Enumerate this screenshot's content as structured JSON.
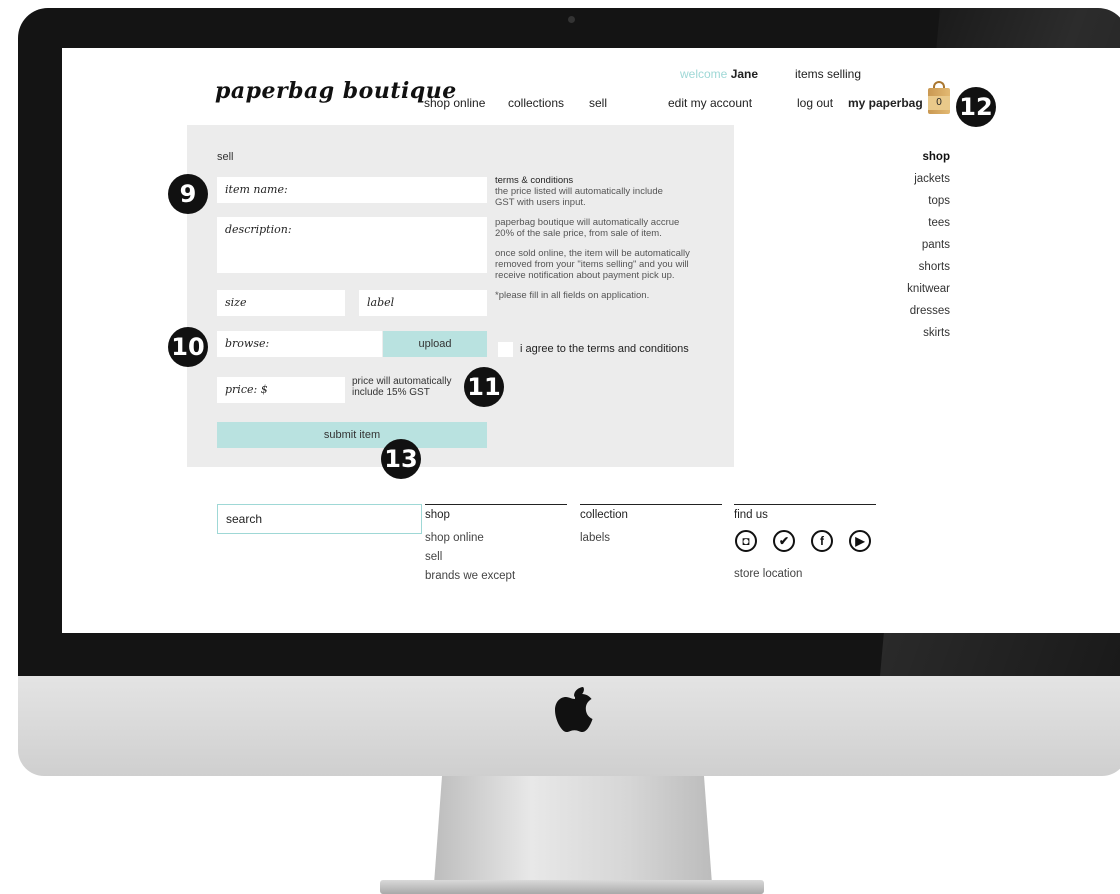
{
  "header": {
    "logo": "paperbag boutique",
    "nav": [
      "shop online",
      "collections",
      "sell"
    ],
    "welcome_prefix": "welcome",
    "user_name": "Jane",
    "items_selling": "items selling",
    "edit_account": "edit my account",
    "log_out": "log out",
    "my_paperbag": "my paperbag",
    "bag_count": "0"
  },
  "form": {
    "title": "sell",
    "item_name_placeholder": "item name:",
    "description_placeholder": "description:",
    "size_placeholder": "size",
    "label_placeholder": "label",
    "browse_placeholder": "browse:",
    "upload_label": "upload",
    "price_placeholder": "price: $",
    "price_note_line1": "price will automatically",
    "price_note_line2": "include 15% GST",
    "submit_label": "submit item",
    "agree_label": "i agree to the terms and conditions"
  },
  "terms": {
    "title": "terms & conditions",
    "p1_lines": [
      "the price listed will automatically include",
      "GST with users input."
    ],
    "p2_lines": [
      "paperbag boutique will automatically accrue",
      "20% of the sale price, from sale of item."
    ],
    "p3_lines": [
      "once sold online, the item will be automatically",
      "removed from your \"items selling\" and you will",
      "receive notification about payment pick up."
    ],
    "p4": "*please fill in all fields on application."
  },
  "sidebar": {
    "title": "shop",
    "items": [
      "jackets",
      "tops",
      "tees",
      "pants",
      "shorts",
      "knitwear",
      "dresses",
      "skirts"
    ]
  },
  "footer": {
    "search_placeholder": "search",
    "shop_title": "shop",
    "shop_links": [
      "shop online",
      "sell",
      "brands we except"
    ],
    "collection_title": "collection",
    "collection_links": [
      "labels"
    ],
    "findus_title": "find us",
    "social_icons": [
      "instagram-icon",
      "twitter-icon",
      "facebook-icon",
      "youtube-icon"
    ],
    "store_location": "store location"
  },
  "callouts": [
    "9",
    "10",
    "11",
    "12",
    "13"
  ],
  "colors": {
    "accent": "#9fd8d6",
    "button": "#b9e2e0",
    "panel": "#ececec",
    "bezel": "#141414"
  }
}
